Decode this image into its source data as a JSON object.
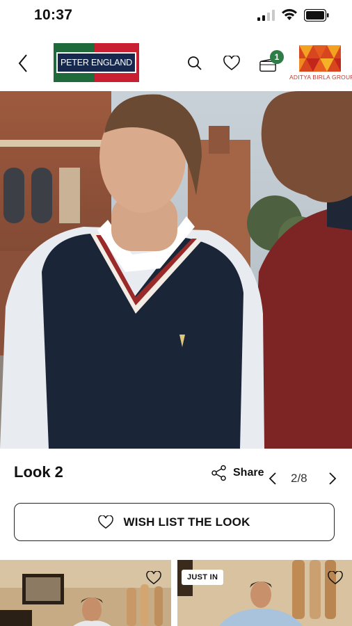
{
  "status_bar": {
    "time": "10:37"
  },
  "header": {
    "brand_name": "PETER ENGLAND",
    "partner_name": "ADITYA BIRLA GROUP",
    "cart_count": "1",
    "icons": [
      "chevron-left-icon",
      "search-icon",
      "heart-icon",
      "cart-icon"
    ]
  },
  "look": {
    "title": "Look 2",
    "share_label": "Share",
    "pager": "2/8",
    "wishlist_label": "WISH LIST THE LOOK"
  },
  "products": [
    {
      "tag": ""
    },
    {
      "tag": "JUST IN"
    }
  ],
  "colors": {
    "brand_green": "#1f6a3b",
    "brand_red": "#c82032",
    "brand_navy": "#17284f",
    "badge_green": "#2e7d46"
  }
}
